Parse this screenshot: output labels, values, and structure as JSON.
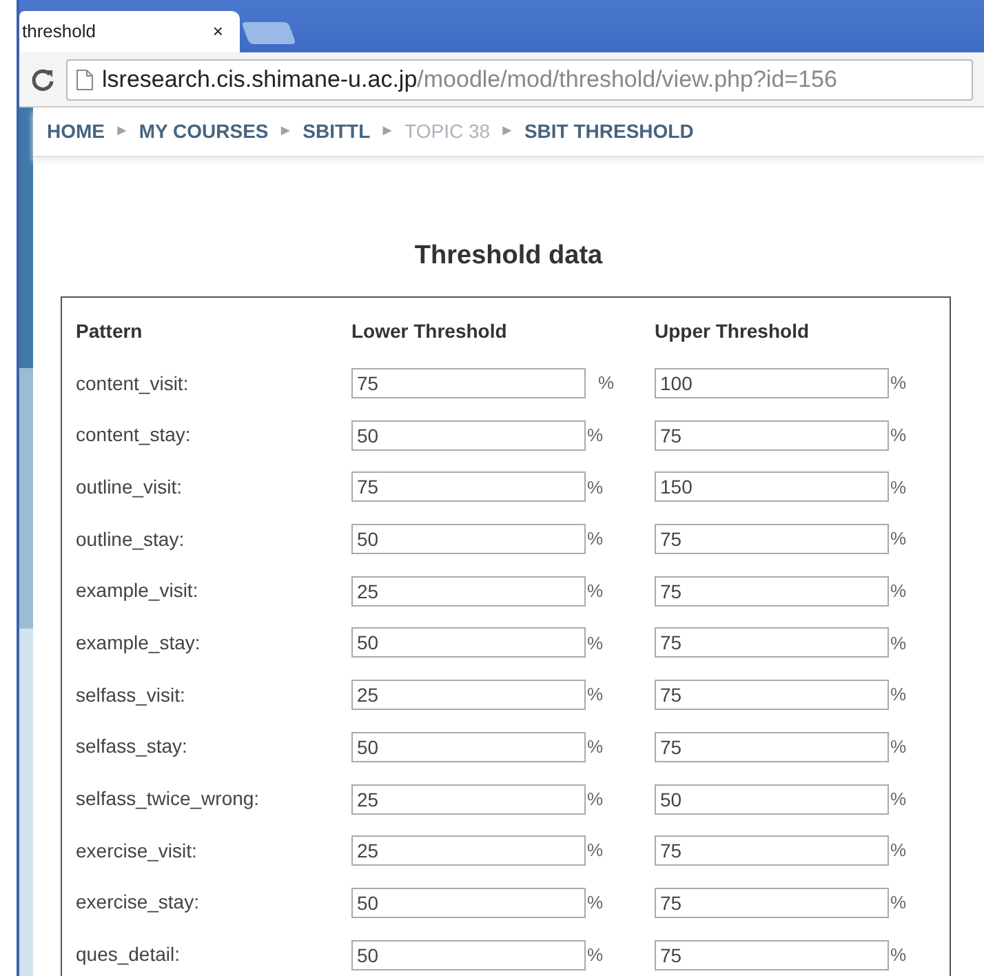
{
  "browser": {
    "tab": {
      "title": "threshold",
      "close": "×"
    },
    "address": {
      "host": "lsresearch.cis.shimane-u.ac.jp",
      "path": "/moodle/mod/threshold/view.php?id=156"
    }
  },
  "breadcrumb": [
    {
      "label": "HOME",
      "muted": false
    },
    {
      "label": "MY COURSES",
      "muted": false
    },
    {
      "label": "SBITTL",
      "muted": false
    },
    {
      "label": "TOPIC 38",
      "muted": true
    },
    {
      "label": "SBIT THRESHOLD",
      "muted": false
    }
  ],
  "breadcrumb_separator": "►",
  "title": "Threshold data",
  "table": {
    "columns": [
      "Pattern",
      "Lower Threshold",
      "Upper Threshold"
    ],
    "unit": "%",
    "rows": [
      {
        "pattern": "content_visit:",
        "lower": "75",
        "upper": "100"
      },
      {
        "pattern": "content_stay:",
        "lower": "50",
        "upper": "75"
      },
      {
        "pattern": "outline_visit:",
        "lower": "75",
        "upper": "150"
      },
      {
        "pattern": "outline_stay:",
        "lower": "50",
        "upper": "75"
      },
      {
        "pattern": "example_visit:",
        "lower": "25",
        "upper": "75"
      },
      {
        "pattern": "example_stay:",
        "lower": "50",
        "upper": "75"
      },
      {
        "pattern": "selfass_visit:",
        "lower": "25",
        "upper": "75"
      },
      {
        "pattern": "selfass_stay:",
        "lower": "50",
        "upper": "75"
      },
      {
        "pattern": "selfass_twice_wrong:",
        "lower": "25",
        "upper": "50"
      },
      {
        "pattern": "exercise_visit:",
        "lower": "25",
        "upper": "75"
      },
      {
        "pattern": "exercise_stay:",
        "lower": "50",
        "upper": "75"
      },
      {
        "pattern": "ques_detail:",
        "lower": "50",
        "upper": "75"
      }
    ]
  }
}
